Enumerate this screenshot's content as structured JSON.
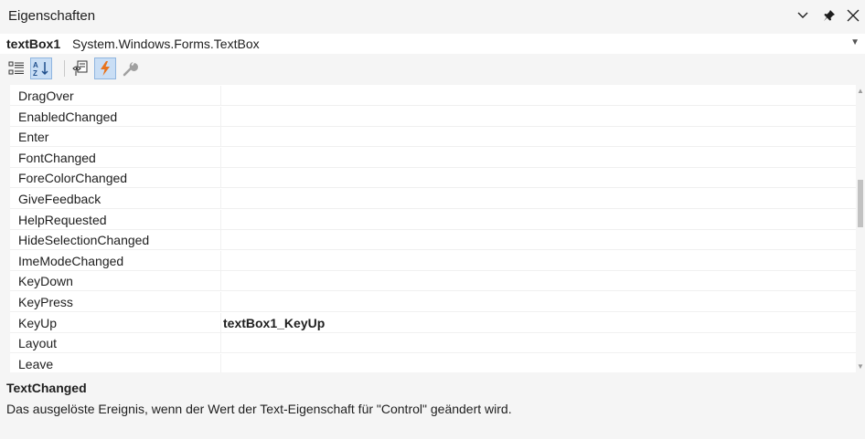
{
  "window": {
    "title": "Eigenschaften",
    "icons": [
      "chevron-down-icon",
      "pin-icon",
      "close-icon"
    ]
  },
  "object_selector": {
    "name": "textBox1",
    "type": "System.Windows.Forms.TextBox"
  },
  "toolbar": {
    "buttons": [
      {
        "name": "categorized-icon",
        "active": false
      },
      {
        "name": "alphabetical-icon",
        "active": true
      },
      {
        "name": "properties-icon",
        "active": false
      },
      {
        "name": "events-icon",
        "active": true
      },
      {
        "name": "property-pages-icon",
        "active": false
      }
    ]
  },
  "grid": {
    "rows": [
      {
        "name": "DragOver",
        "value": ""
      },
      {
        "name": "EnabledChanged",
        "value": ""
      },
      {
        "name": "Enter",
        "value": ""
      },
      {
        "name": "FontChanged",
        "value": ""
      },
      {
        "name": "ForeColorChanged",
        "value": ""
      },
      {
        "name": "GiveFeedback",
        "value": ""
      },
      {
        "name": "HelpRequested",
        "value": ""
      },
      {
        "name": "HideSelectionChanged",
        "value": ""
      },
      {
        "name": "ImeModeChanged",
        "value": ""
      },
      {
        "name": "KeyDown",
        "value": ""
      },
      {
        "name": "KeyPress",
        "value": ""
      },
      {
        "name": "KeyUp",
        "value": "textBox1_KeyUp"
      },
      {
        "name": "Layout",
        "value": ""
      },
      {
        "name": "Leave",
        "value": ""
      }
    ]
  },
  "description": {
    "title": "TextChanged",
    "text": "Das ausgelöste Ereignis, wenn der Wert der Text-Eigenschaft für \"Control\" geändert wird."
  },
  "colors": {
    "background": "#f5f5f5",
    "grid_background": "#ffffff",
    "active_button": "#c9def5",
    "events_icon": "#e8731c"
  }
}
